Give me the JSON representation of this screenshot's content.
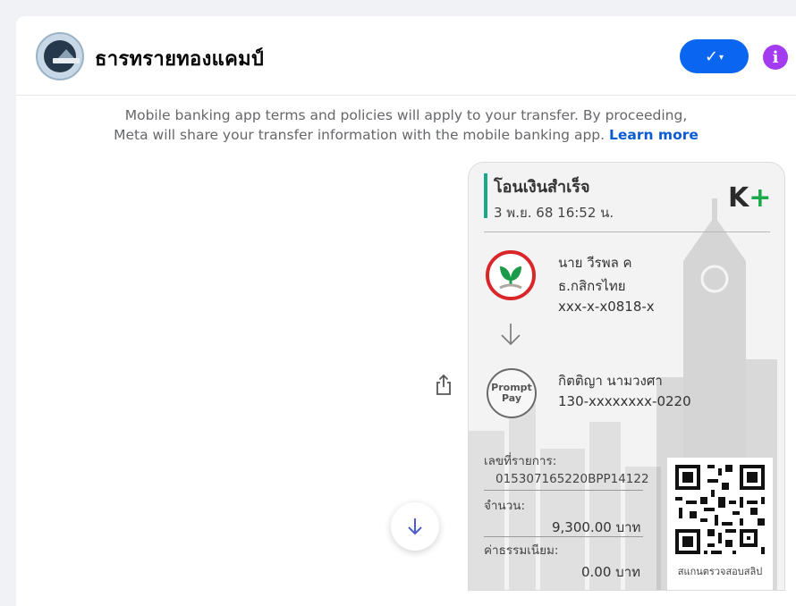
{
  "header": {
    "title": "ธารทรายทองแคมป์",
    "menu_button_icon": "checkmark-dropdown-icon",
    "info_icon": "info-icon",
    "colors": {
      "menu_button": "#0a66f0",
      "info_button": "#a33cf0"
    }
  },
  "notice": {
    "line1": "Mobile banking app terms and policies will apply to your transfer. By proceeding,",
    "line2": "Meta will share your transfer information with the mobile banking app.",
    "learn_more": "Learn more"
  },
  "slip": {
    "status": "โอนเงินสำเร็จ",
    "datetime": "3 พ.ย. 68  16:52 น.",
    "brand_k": "K",
    "brand_plus": "+",
    "from": {
      "name": "นาย วีรพล ค",
      "bank": "ธ.กสิกรไทย",
      "account": "xxx-x-x0818-x"
    },
    "to": {
      "logo_line1": "Prompt",
      "logo_line2": "Pay",
      "name": "กิตติญา นามวงศา",
      "account": "130-xxxxxxxx-0220"
    },
    "reference_label": "เลขที่รายการ:",
    "reference_value": "015307165220BPP14122",
    "amount_label": "จำนวน:",
    "amount_value": "9,300.00 บาท",
    "fee_label": "ค่าธรรมเนียม:",
    "fee_value": "0.00 บาท",
    "qr_caption": "สแกนตรวจสอบสลิป",
    "colors": {
      "accent_green": "#1aa88a",
      "kbank_red": "#d9262a"
    }
  }
}
